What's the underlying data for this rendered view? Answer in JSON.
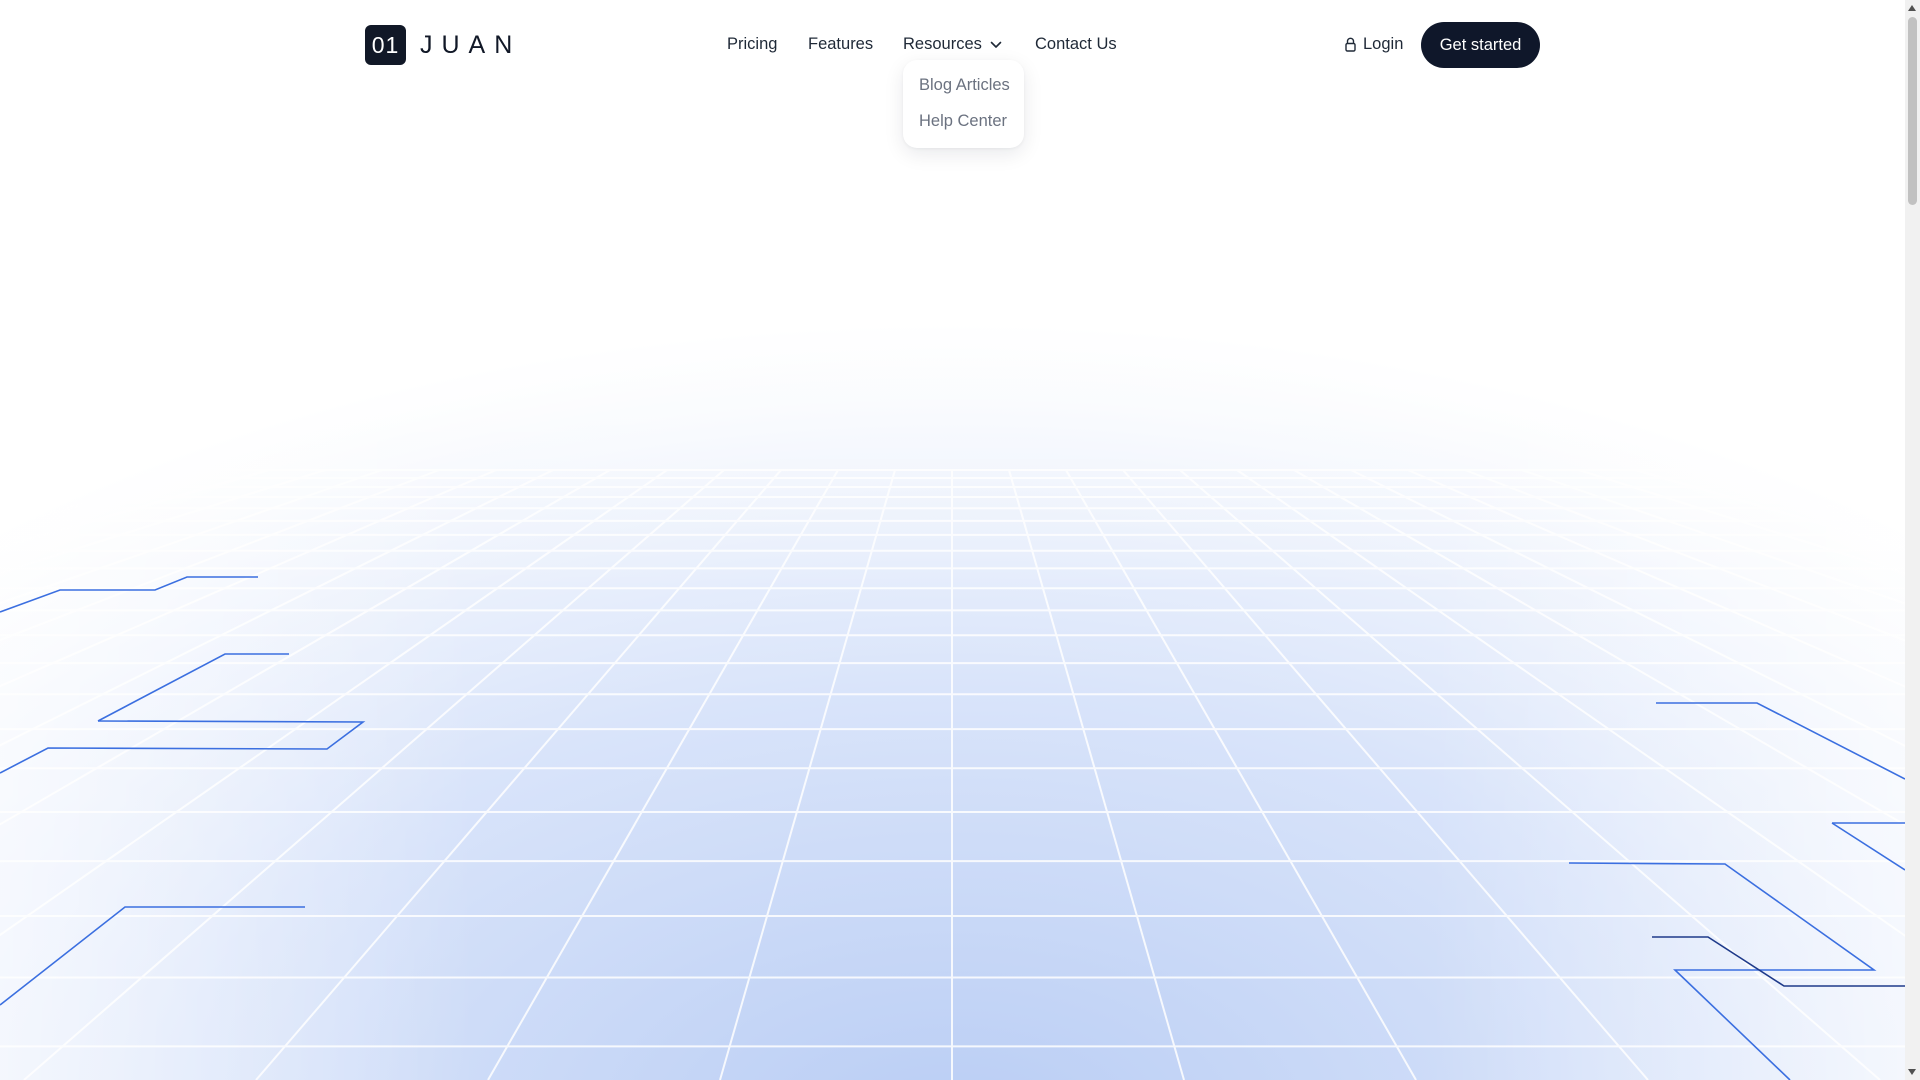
{
  "brand": {
    "badge": "01",
    "name": "JUAN"
  },
  "nav": {
    "links": [
      "Pricing",
      "Features",
      "Resources",
      "Contact Us"
    ],
    "resources_menu": [
      "Blog Articles",
      "Help Center"
    ]
  },
  "actions": {
    "login": "Login",
    "cta": "Get started"
  },
  "icons": {
    "resources_caret": "chevron-down-icon",
    "login": "lock-icon",
    "scroll_up": "caret-up-icon",
    "scroll_down": "caret-down-icon"
  },
  "colors": {
    "primary_dark": "#0f172a",
    "accent_blue": "#3b6fe0",
    "grid_tint": "#c5d6f5"
  }
}
